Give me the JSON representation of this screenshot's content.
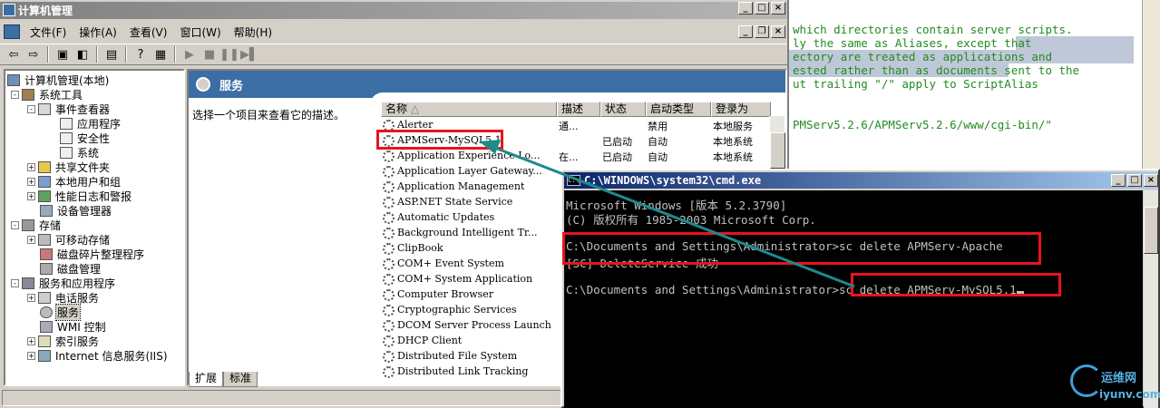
{
  "editor": {
    "lines": [
      "which directories contain server scripts.",
      "ly the same as Aliases, except that",
      "ectory are treated as applications and",
      "ested rather than as documents sent to the",
      "ut trailing \"/\" apply to ScriptAlias",
      "",
      "PMServ5.2.6/APMServ5.2.6/www/cgi-bin/\""
    ]
  },
  "mmc": {
    "title": "计算机管理",
    "menu": [
      "文件(F)",
      "操作(A)",
      "查看(V)",
      "窗口(W)",
      "帮助(H)"
    ],
    "tree": [
      {
        "label": "计算机管理(本地)",
        "box": ""
      },
      {
        "label": "系统工具",
        "box": "-"
      },
      {
        "label": "事件查看器",
        "box": "-"
      },
      {
        "label": "应用程序",
        "box": ""
      },
      {
        "label": "安全性",
        "box": ""
      },
      {
        "label": "系统",
        "box": ""
      },
      {
        "label": "共享文件夹",
        "box": "+"
      },
      {
        "label": "本地用户和组",
        "box": "+"
      },
      {
        "label": "性能日志和警报",
        "box": "+"
      },
      {
        "label": "设备管理器",
        "box": ""
      },
      {
        "label": "存储",
        "box": "-"
      },
      {
        "label": "可移动存储",
        "box": "+"
      },
      {
        "label": "磁盘碎片整理程序",
        "box": ""
      },
      {
        "label": "磁盘管理",
        "box": ""
      },
      {
        "label": "服务和应用程序",
        "box": "-"
      },
      {
        "label": "电话服务",
        "box": "+"
      },
      {
        "label": "服务",
        "box": ""
      },
      {
        "label": "WMI 控制",
        "box": ""
      },
      {
        "label": "索引服务",
        "box": "+"
      },
      {
        "label": "Internet 信息服务(IIS)",
        "box": "+"
      }
    ],
    "pane_title": "服务",
    "description_prompt": "选择一个项目来查看它的描述。",
    "columns": [
      "名称",
      "描述",
      "状态",
      "启动类型",
      "登录为"
    ],
    "services": [
      {
        "name": "Alerter",
        "desc": "通...",
        "status": "",
        "startup": "禁用",
        "logon": "本地服务"
      },
      {
        "name": "APMServ-MySQL5.1",
        "desc": "",
        "status": "已启动",
        "startup": "自动",
        "logon": "本地系统"
      },
      {
        "name": "Application Experience Lo...",
        "desc": "在...",
        "status": "已启动",
        "startup": "自动",
        "logon": "本地系统"
      },
      {
        "name": "Application Layer Gateway...",
        "desc": "",
        "status": "",
        "startup": "",
        "logon": ""
      },
      {
        "name": "Application Management",
        "desc": "",
        "status": "",
        "startup": "",
        "logon": ""
      },
      {
        "name": "ASP.NET State Service",
        "desc": "",
        "status": "",
        "startup": "",
        "logon": ""
      },
      {
        "name": "Automatic Updates",
        "desc": "",
        "status": "",
        "startup": "",
        "logon": ""
      },
      {
        "name": "Background Intelligent Tr...",
        "desc": "",
        "status": "",
        "startup": "",
        "logon": ""
      },
      {
        "name": "ClipBook",
        "desc": "",
        "status": "",
        "startup": "",
        "logon": ""
      },
      {
        "name": "COM+ Event System",
        "desc": "",
        "status": "",
        "startup": "",
        "logon": ""
      },
      {
        "name": "COM+ System Application",
        "desc": "",
        "status": "",
        "startup": "",
        "logon": ""
      },
      {
        "name": "Computer Browser",
        "desc": "",
        "status": "",
        "startup": "",
        "logon": ""
      },
      {
        "name": "Cryptographic Services",
        "desc": "",
        "status": "",
        "startup": "",
        "logon": ""
      },
      {
        "name": "DCOM Server Process Launcher",
        "desc": "",
        "status": "",
        "startup": "",
        "logon": ""
      },
      {
        "name": "DHCP Client",
        "desc": "",
        "status": "",
        "startup": "",
        "logon": ""
      },
      {
        "name": "Distributed File System",
        "desc": "",
        "status": "",
        "startup": "",
        "logon": ""
      },
      {
        "name": "Distributed Link Tracking",
        "desc": "",
        "status": "",
        "startup": "",
        "logon": ""
      }
    ],
    "tabs": [
      "扩展",
      "标准"
    ]
  },
  "cmd": {
    "title": "C:\\WINDOWS\\system32\\cmd.exe",
    "icon_text": "C:\\",
    "lines": [
      "Microsoft Windows [版本 5.2.3790]",
      "(C) 版权所有 1985-2003 Microsoft Corp.",
      "",
      "C:\\Documents and Settings\\Administrator>sc delete APMServ-Apache",
      "[SC] DeleteService 成功",
      "",
      "C:\\Documents and Settings\\Administrator>sc delete APMServ-MySQL5.1"
    ]
  },
  "watermark": {
    "line1": "运维网",
    "line2": "iyunv.com"
  },
  "colors": {
    "annotation_red": "#e8141c",
    "arrow_teal": "#1e8a8a",
    "console_bg": "#000000",
    "pane_blue": "#3a6ea5"
  }
}
